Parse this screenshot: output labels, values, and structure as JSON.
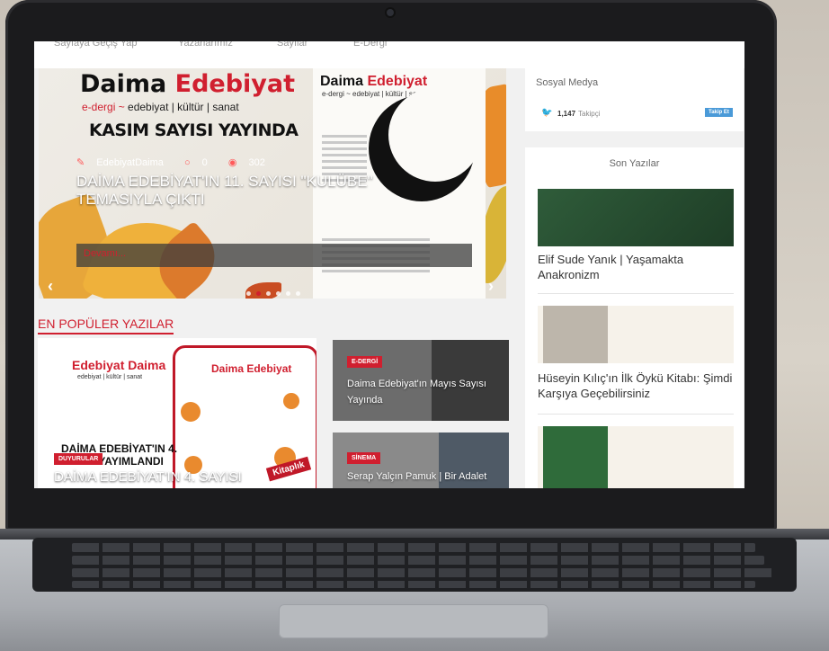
{
  "nav": {
    "items": [
      "Sayfaya Geçiş Yap",
      "Yazarlarımız",
      "Sayılar",
      "E-Dergi"
    ]
  },
  "slider": {
    "brand_a": "Daima ",
    "brand_b": "Edebiyat",
    "tagline_a": "e-dergi ~ ",
    "tagline_b": "edebiyat | kültür | sanat",
    "headline": "KASIM SAYISI YAYINDA",
    "cover_brand_a": "Daima ",
    "cover_brand_b": "Edebiyat",
    "cover_sub": "e-dergi ~ edebiyat | kültür | sanat",
    "author": "EdebiyatDaima",
    "comments": "0",
    "views": "302",
    "title": "DAİMA EDEBİYAT'IN 11. SAYISI \"KULÜBE\" TEMASIYLA ÇIKTI",
    "more": "Devamı..."
  },
  "popular": {
    "heading": "EN POPÜLER YAZILAR",
    "card1": {
      "brand": "Edebiyat Daima",
      "tag": "edebiyat | kültür | sanat",
      "poster_title": "Daima Edebiyat",
      "headline": "DAİMA EDEBİYAT'IN 4. SAYISI YAYIMLANDI",
      "badge": "DUYURULAR",
      "title": "DAİMA EDEBİYAT'IN 4. SAYISI",
      "ribbon": "Kitaplık"
    },
    "card2": {
      "badge": "E-DERGİ",
      "title": "Daima Edebiyat'ın Mayıs Sayısı Yayında"
    },
    "card3": {
      "badge": "SİNEMA",
      "title": "Serap Yalçın Pamuk | Bir Adalet"
    }
  },
  "social": {
    "label": "Sosyal Medya",
    "followers": "1,147",
    "followers_label": "Takipçi",
    "follow_button": "Takip Et"
  },
  "recent": {
    "heading": "Son Yazılar",
    "posts": [
      {
        "title": "Elif Sude Yanık | Yaşamakta Anakronizm"
      },
      {
        "title": "Hüseyin Kılıç'ın İlk Öykü Kitabı: Şimdi Karşıya Geçebilirsiniz"
      }
    ]
  },
  "colors": {
    "accent": "#d01f2f",
    "twitter": "#3b9cdb"
  }
}
